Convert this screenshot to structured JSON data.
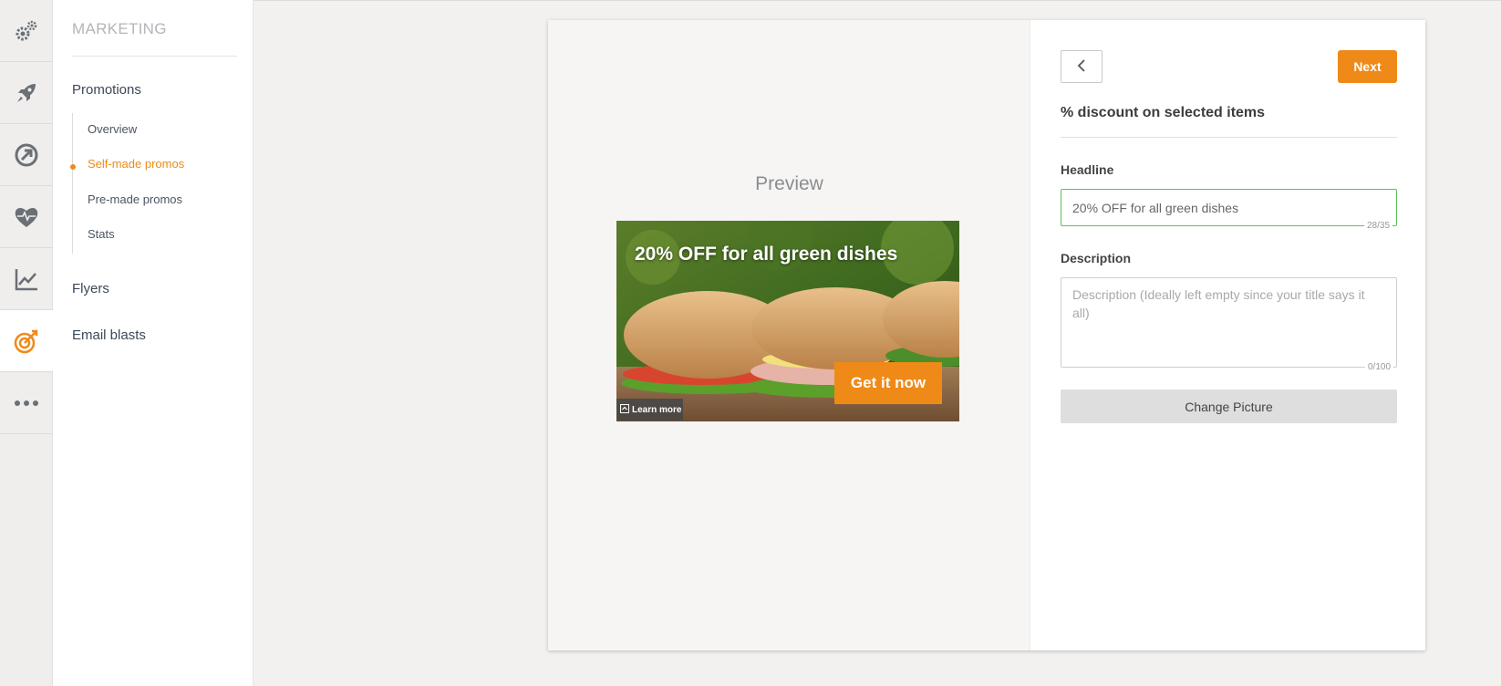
{
  "rail": {
    "items": [
      {
        "icon": "gears-icon",
        "active": false
      },
      {
        "icon": "rocket-icon",
        "active": false
      },
      {
        "icon": "arrow-circle-icon",
        "active": false
      },
      {
        "icon": "heart-pulse-icon",
        "active": false
      },
      {
        "icon": "line-chart-icon",
        "active": false
      },
      {
        "icon": "target-icon",
        "active": true
      },
      {
        "icon": "more-dots-icon",
        "active": false
      }
    ],
    "accent": "#ef8a18"
  },
  "sidebar": {
    "title": "MARKETING",
    "promotions": "Promotions",
    "sub": [
      "Overview",
      "Self-made promos",
      "Pre-made promos",
      "Stats"
    ],
    "active_sub": "Self-made promos",
    "flyers": "Flyers",
    "email_blasts": "Email blasts"
  },
  "preview": {
    "label": "Preview",
    "ad_headline": "20% OFF for all green dishes",
    "ad_cta": "Get it now",
    "ad_learn": "Learn more"
  },
  "form": {
    "title": "% discount on selected items",
    "next_label": "Next",
    "headline_label": "Headline",
    "headline_value": "20% OFF for all green dishes",
    "headline_counter": "28/35",
    "description_label": "Description",
    "description_placeholder": "Description (Ideally left empty since your title says it all)",
    "description_counter": "0/100",
    "change_picture": "Change Picture"
  },
  "colors": {
    "accent": "#ef8a18",
    "valid_border": "#5cc15c"
  }
}
